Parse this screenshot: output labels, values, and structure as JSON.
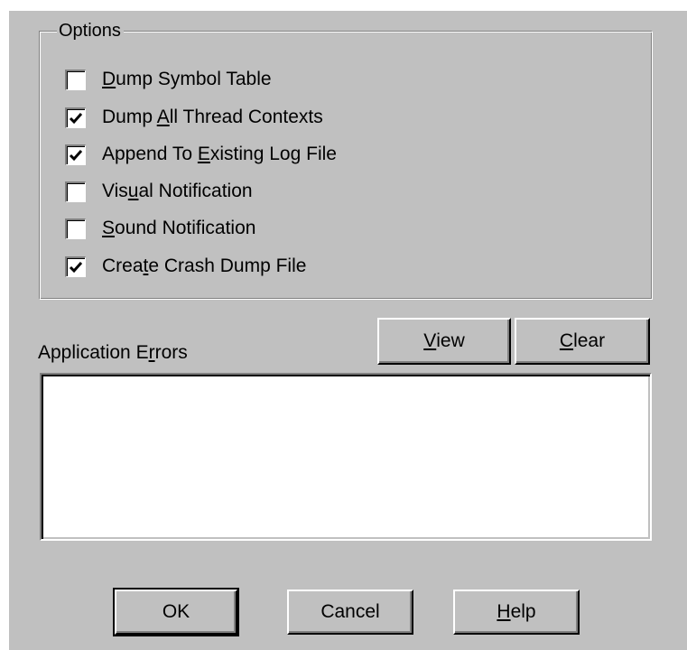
{
  "options_group": {
    "title": "Options",
    "items": [
      {
        "label_pre": "",
        "label_accel": "D",
        "label_post": "ump Symbol Table",
        "checked": false
      },
      {
        "label_pre": "Dump ",
        "label_accel": "A",
        "label_post": "ll Thread Contexts",
        "checked": true
      },
      {
        "label_pre": "Append To ",
        "label_accel": "E",
        "label_post": "xisting Log File",
        "checked": true
      },
      {
        "label_pre": "Vis",
        "label_accel": "u",
        "label_post": "al Notification",
        "checked": false
      },
      {
        "label_pre": "",
        "label_accel": "S",
        "label_post": "ound Notification",
        "checked": false
      },
      {
        "label_pre": "Crea",
        "label_accel": "t",
        "label_post": "e Crash Dump File",
        "checked": true
      }
    ]
  },
  "app_errors": {
    "label_pre": "Application E",
    "label_accel": "r",
    "label_post": "rors",
    "view_pre": "",
    "view_accel": "V",
    "view_post": "iew",
    "clear_pre": "",
    "clear_accel": "C",
    "clear_post": "lear"
  },
  "footer": {
    "ok_label": "OK",
    "cancel_label": "Cancel",
    "help_pre": "",
    "help_accel": "H",
    "help_post": "elp"
  },
  "colors": {
    "face": "#c0c0c0",
    "highlight": "#ffffff",
    "shadow": "#808080",
    "dark": "#000000"
  }
}
